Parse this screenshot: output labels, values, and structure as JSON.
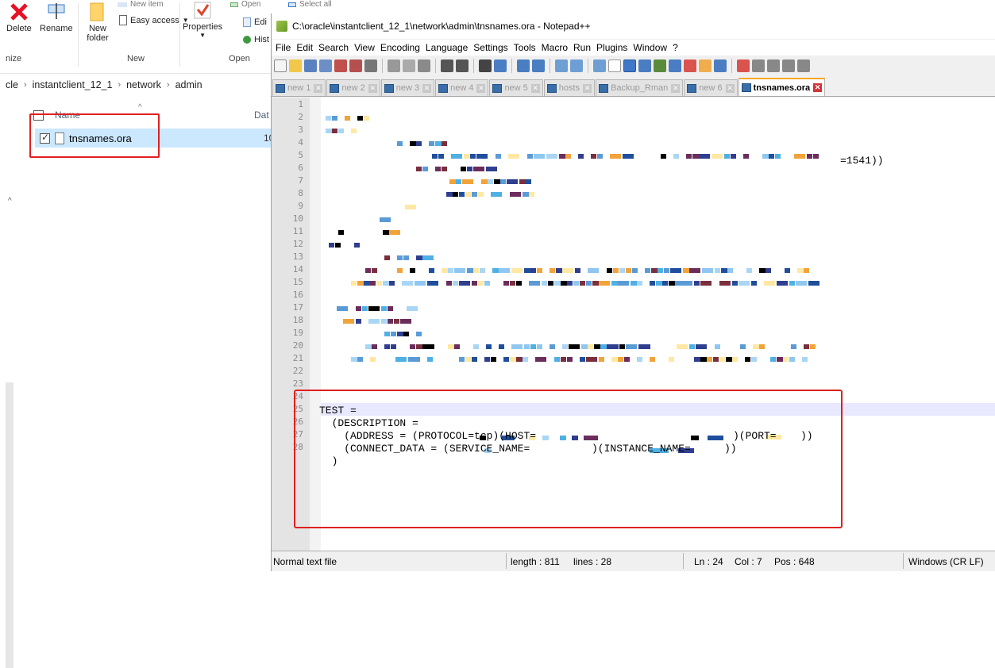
{
  "explorer": {
    "ribbon": {
      "delete_label": "Delete",
      "rename_label": "Rename",
      "new_folder_label": "New folder",
      "easy_access_label": "Easy access",
      "properties_label": "Properties",
      "edit_label": "Edi",
      "history_label": "Hist",
      "new_item_label": "New item",
      "open_top_label": "Open",
      "select_all_label": "Select all",
      "group_organize": "nize",
      "group_new": "New",
      "group_open": "Open"
    },
    "breadcrumb": [
      "cle",
      "instantclient_12_1",
      "network",
      "admin"
    ],
    "columns": {
      "name": "Name",
      "date": "Dat"
    },
    "file": {
      "name": "tnsnames.ora",
      "date": "10/"
    }
  },
  "notepad": {
    "title": "C:\\oracle\\instantclient_12_1\\network\\admin\\tnsnames.ora - Notepad++",
    "menu": [
      "File",
      "Edit",
      "Search",
      "View",
      "Encoding",
      "Language",
      "Settings",
      "Tools",
      "Macro",
      "Run",
      "Plugins",
      "Window",
      "?"
    ],
    "tabs": [
      {
        "label": "new 1",
        "active": false
      },
      {
        "label": "new 2",
        "active": false
      },
      {
        "label": "new 3",
        "active": false
      },
      {
        "label": "new 4",
        "active": false
      },
      {
        "label": "new 5",
        "active": false
      },
      {
        "label": "hosts",
        "active": false
      },
      {
        "label": "Backup_Rman",
        "active": false
      },
      {
        "label": "new 6",
        "active": false
      },
      {
        "label": "tnsnames.ora",
        "active": true
      }
    ],
    "line_numbers": [
      "1",
      "2",
      "3",
      "4",
      "5",
      "6",
      "7",
      "8",
      "9",
      "10",
      "11",
      "12",
      "13",
      "14",
      "15",
      "16",
      "17",
      "18",
      "19",
      "20",
      "21",
      "22",
      "23",
      "24",
      "25",
      "26",
      "27",
      "28"
    ],
    "code": {
      "line5_tail": "=1541))",
      "line24": "TEST =",
      "line25": "  (DESCRIPTION =",
      "line26_a": "    (ADDRESS = (PROTOCOL=tcp)(HOST=",
      "line26_b": ")(PORT=",
      "line26_c": "))",
      "line27_a": "    (CONNECT_DATA = (SERVICE_NAME=",
      "line27_b": ")(INSTANCE_NAME=",
      "line27_c": "))",
      "line28": "  )"
    },
    "status": {
      "file_type": "Normal text file",
      "length": "length : 811",
      "lines": "lines : 28",
      "ln": "Ln : 24",
      "col": "Col : 7",
      "pos": "Pos : 648",
      "eol": "Windows (CR LF)"
    }
  }
}
